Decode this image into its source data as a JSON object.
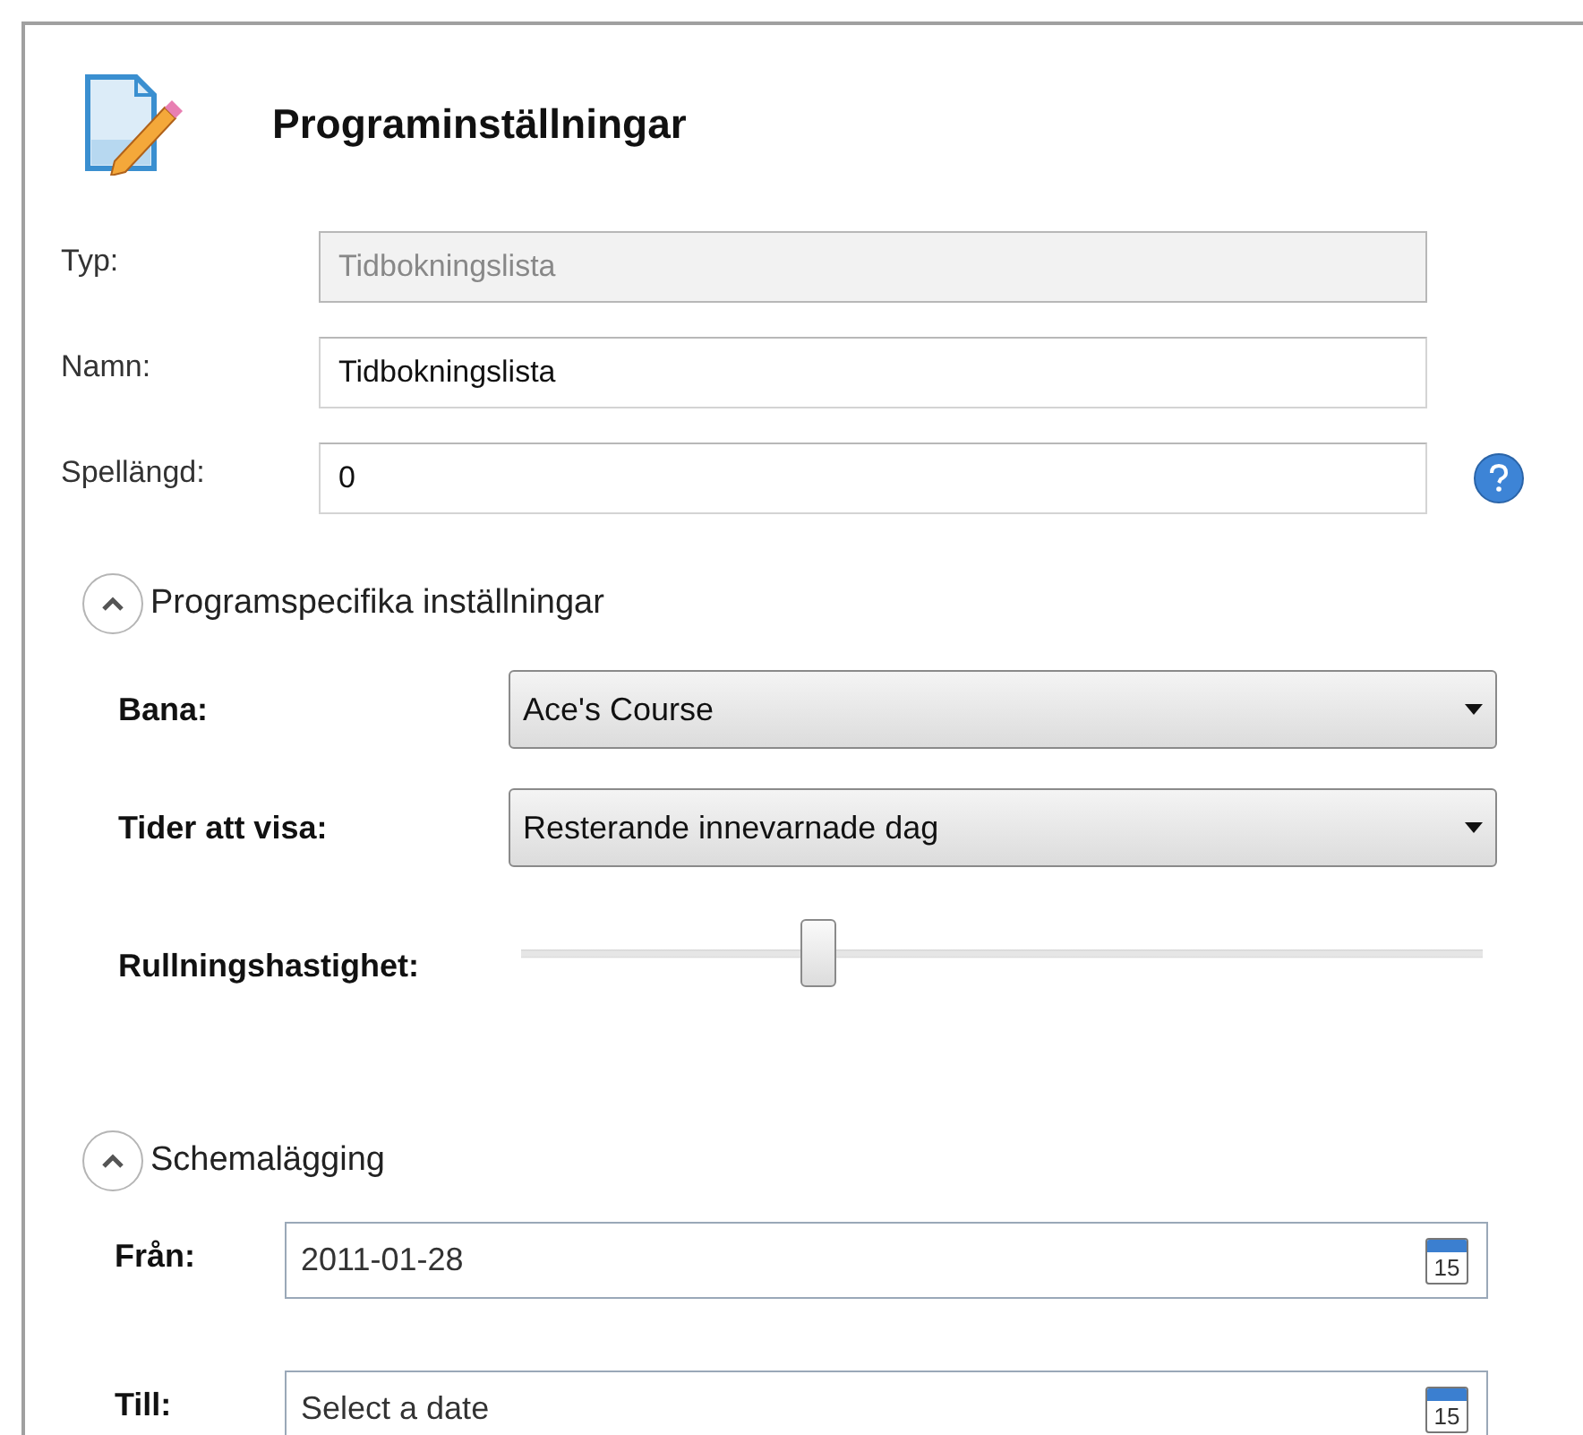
{
  "title": "Programinställningar",
  "fields": [
    {
      "label": "Typ:",
      "value": "Tidbokningslista",
      "disabled": true,
      "help": false
    },
    {
      "label": "Namn:",
      "value": "Tidbokningslista",
      "disabled": false,
      "help": false
    },
    {
      "label": "Spellängd:",
      "value": "0",
      "disabled": false,
      "help": true
    }
  ],
  "program_section": {
    "header": "Programspecifika inställningar",
    "expanded": true,
    "rows": [
      {
        "kind": "dropdown",
        "label": "Bana:",
        "value": "Ace's Course"
      },
      {
        "kind": "dropdown",
        "label": "Tider att visa:",
        "value": "Resterande innevarnade dag"
      },
      {
        "kind": "slider",
        "label": "Rullningshastighet:",
        "level": 0.31
      }
    ]
  },
  "schedule_section": {
    "header": "Schemalägging",
    "expanded": true,
    "dates": [
      {
        "label": "Från:",
        "value": "2011-01-28",
        "calendar_day": "15"
      },
      {
        "label": "Till:",
        "placeholder": "Select a date",
        "calendar_day": "15"
      }
    ]
  }
}
